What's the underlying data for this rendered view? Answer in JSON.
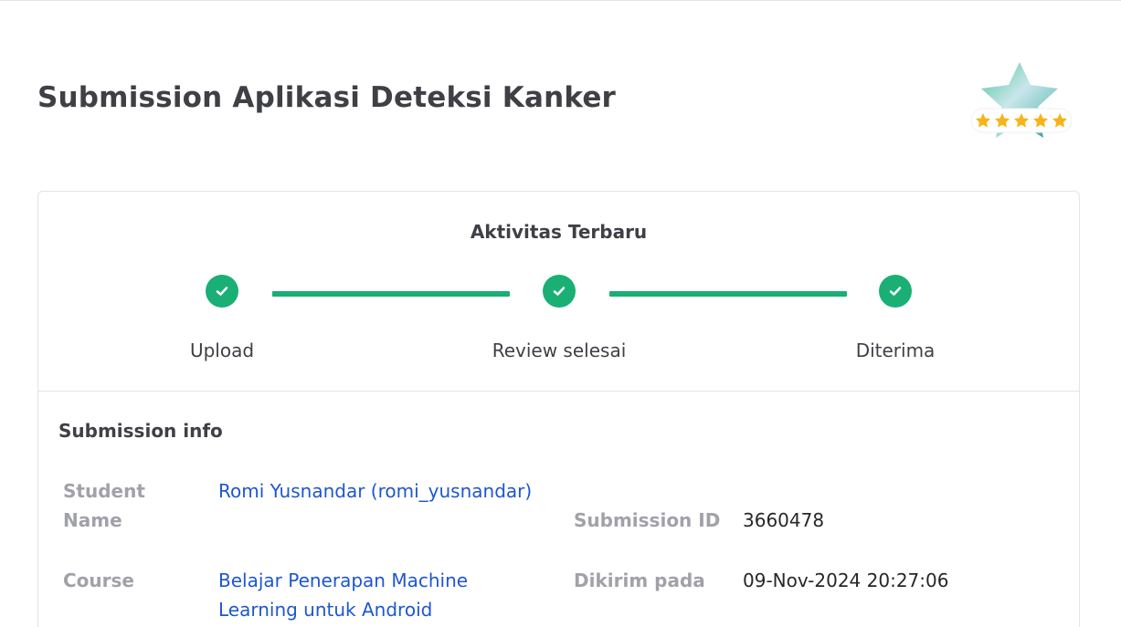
{
  "page": {
    "title": "Submission Aplikasi Deteksi Kanker"
  },
  "activity": {
    "title": "Aktivitas Terbaru",
    "steps": [
      {
        "label": "Upload",
        "status": "done"
      },
      {
        "label": "Review selesai",
        "status": "done"
      },
      {
        "label": "Diterima",
        "status": "done"
      }
    ]
  },
  "submission_info": {
    "title": "Submission info",
    "student_name_label": "Student Name",
    "student_name_value": "Romi Yusnandar (romi_yusnandar)",
    "submission_id_label": "Submission ID",
    "submission_id_value": "3660478",
    "course_label": "Course",
    "course_value": "Belajar Penerapan Machine Learning untuk Android",
    "submitted_at_label": "Dikirim pada",
    "submitted_at_value": "09-Nov-2024 20:27:06"
  },
  "rating": {
    "stars": 5,
    "max_stars": 5
  },
  "colors": {
    "step_done": "#1aaf75",
    "link": "#1e56d0",
    "star": "#f6b41a"
  },
  "icons": {
    "step": "check-icon",
    "badge": "star-rating-badge-icon"
  }
}
